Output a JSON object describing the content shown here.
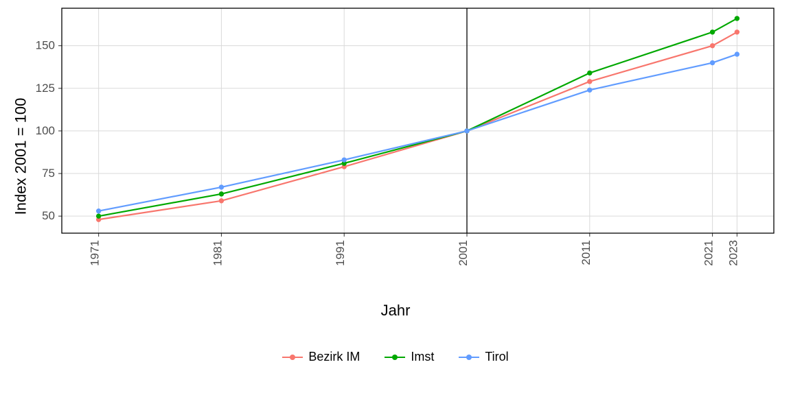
{
  "chart_data": {
    "type": "line",
    "title": "",
    "xlabel": "Jahr",
    "ylabel": "Index 2001 = 100",
    "x": [
      1971,
      1981,
      1991,
      2001,
      2011,
      2021,
      2023
    ],
    "x_ticks": [
      1971,
      1981,
      1991,
      2001,
      2011,
      2021,
      2023
    ],
    "y_ticks": [
      50,
      75,
      100,
      125,
      150
    ],
    "xlim": [
      1968,
      2026
    ],
    "ylim": [
      40,
      172
    ],
    "reference_vline_x": 2001,
    "legend_position": "bottom",
    "grid": true,
    "series": [
      {
        "name": "Bezirk IM",
        "color": "#F8766D",
        "values": [
          48,
          59,
          79,
          100,
          129,
          150,
          158
        ]
      },
      {
        "name": "Imst",
        "color": "#00A800",
        "values": [
          50,
          63,
          81,
          100,
          134,
          158,
          166
        ]
      },
      {
        "name": "Tirol",
        "color": "#619CFF",
        "values": [
          53,
          67,
          83,
          100,
          124,
          140,
          145
        ]
      }
    ]
  }
}
